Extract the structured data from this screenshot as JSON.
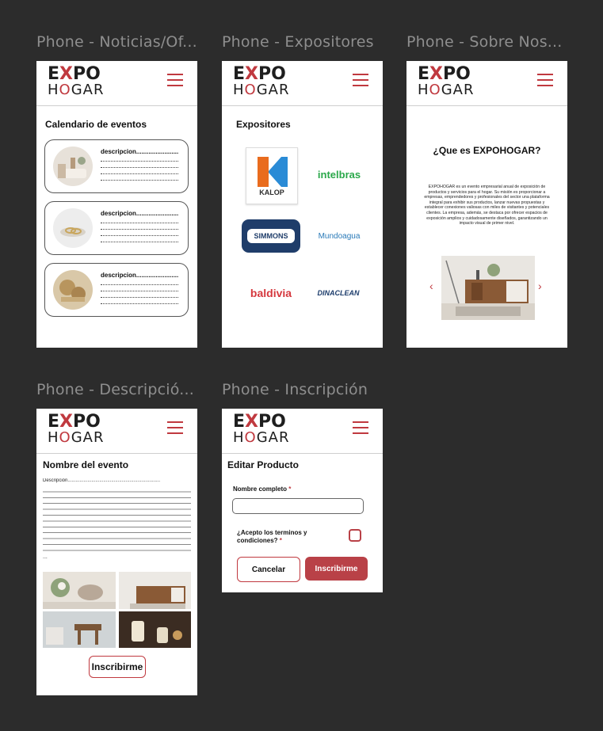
{
  "frames": {
    "noticias": "Phone - Noticias/Of...",
    "expositores": "Phone - Expositores",
    "sobre": "Phone - Sobre Nos...",
    "descripcion": "Phone - Descripció...",
    "inscripcion": "Phone - Inscripción"
  },
  "logo": {
    "top_a": "E",
    "top_x": "X",
    "top_b": "PO",
    "bottom_a": "H",
    "bottom_o": "O",
    "bottom_b": "GAR"
  },
  "noticias": {
    "title": "Calendario de eventos",
    "events": [
      {
        "label": "descripcion........................"
      },
      {
        "label": "descripcion........................"
      },
      {
        "label": "descripcion........................"
      }
    ]
  },
  "expositores": {
    "title": "Expositores",
    "brands": [
      "KALOP",
      "intelbras",
      "SIMMONS",
      "Mundoagua",
      "baldivia",
      "DINACLEAN"
    ]
  },
  "sobre": {
    "title": "¿Que es EXPOHOGAR?",
    "body": "EXPOHOGAR es un evento empresarial anual de exposición de productos y servicios para el hogar. Su misión es proporcionar a empresas, emprendedores y profesionales del sector una plataforma integral para exhibir sus productos, lanzar nuevas propuestas y establecer conexiones valiosas con miles de visitantes y potenciales clientes. La empresa, además, se destaca por ofrecer espacios de exposición amplios y cuidadosamente diseñados, garantizando un impacto visual de primer nivel.",
    "prev": "‹",
    "next": "›"
  },
  "descripcion": {
    "title": "Nombre del evento",
    "desc_label": "Descripción......................................................................",
    "end": "...",
    "button": "Inscribirme"
  },
  "inscripcion": {
    "title": "Editar Producto",
    "name_label": "Nombre completo",
    "required": "*",
    "name_value": "",
    "terms_line1": "¿Acepto los terminos y",
    "terms_line2": "condiciones?",
    "cancel": "Cancelar",
    "submit": "Inscribirme"
  },
  "colors": {
    "accent": "#c0393f",
    "button_fill": "#b94147",
    "canvas": "#2c2c2c"
  }
}
